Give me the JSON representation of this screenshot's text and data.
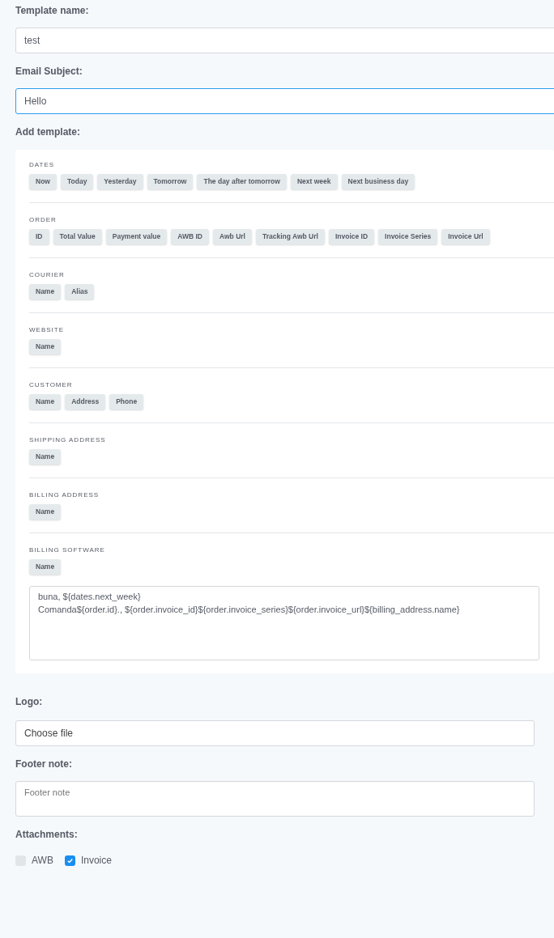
{
  "template_name": {
    "label": "Template name:",
    "value": "test"
  },
  "email_subject": {
    "label": "Email Subject:",
    "value": "Hello",
    "focused": true
  },
  "add_template": {
    "label": "Add template:",
    "groups": [
      {
        "title": "DATES",
        "tags": [
          "Now",
          "Today",
          "Yesterday",
          "Tomorrow",
          "The day after tomorrow",
          "Next week",
          "Next business day"
        ]
      },
      {
        "title": "ORDER",
        "tags": [
          "ID",
          "Total Value",
          "Payment value",
          "AWB ID",
          "Awb Url",
          "Tracking Awb Url",
          "Invoice ID",
          "Invoice Series",
          "Invoice Url"
        ]
      },
      {
        "title": "COURIER",
        "tags": [
          "Name",
          "Alias"
        ]
      },
      {
        "title": "WEBSITE",
        "tags": [
          "Name"
        ]
      },
      {
        "title": "CUSTOMER",
        "tags": [
          "Name",
          "Address",
          "Phone"
        ]
      },
      {
        "title": "SHIPPING ADDRESS",
        "tags": [
          "Name"
        ]
      },
      {
        "title": "BILLING ADDRESS",
        "tags": [
          "Name"
        ]
      },
      {
        "title": "BILLING SOFTWARE",
        "tags": [
          "Name"
        ]
      }
    ],
    "body": "buna, ${dates.next_week}\nComanda${order.id}., ${order.invoice_id}${order.invoice_series}${order.invoice_url}${billing_address.name}"
  },
  "logo": {
    "label": "Logo:",
    "button": "Choose file"
  },
  "footer_note": {
    "label": "Footer note:",
    "placeholder": "Footer note"
  },
  "attachments": {
    "label": "Attachments:",
    "options": [
      {
        "label": "AWB",
        "checked": false
      },
      {
        "label": "Invoice",
        "checked": true
      }
    ]
  }
}
